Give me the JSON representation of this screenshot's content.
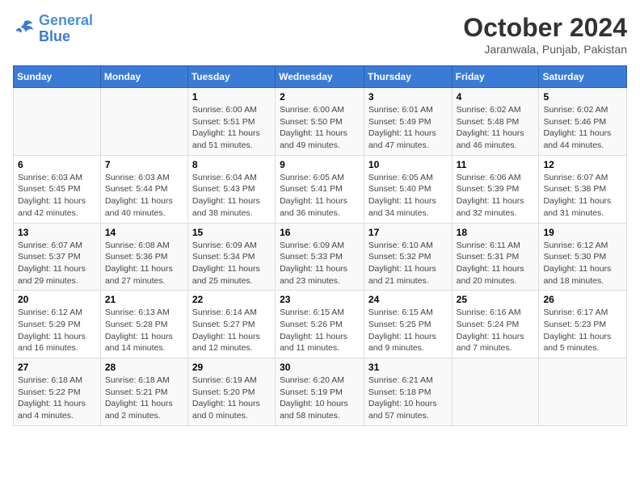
{
  "header": {
    "logo_line1": "General",
    "logo_line2": "Blue",
    "month": "October 2024",
    "location": "Jaranwala, Punjab, Pakistan"
  },
  "weekdays": [
    "Sunday",
    "Monday",
    "Tuesday",
    "Wednesday",
    "Thursday",
    "Friday",
    "Saturday"
  ],
  "weeks": [
    [
      {
        "day": "",
        "info": ""
      },
      {
        "day": "",
        "info": ""
      },
      {
        "day": "1",
        "info": "Sunrise: 6:00 AM\nSunset: 5:51 PM\nDaylight: 11 hours and 51 minutes."
      },
      {
        "day": "2",
        "info": "Sunrise: 6:00 AM\nSunset: 5:50 PM\nDaylight: 11 hours and 49 minutes."
      },
      {
        "day": "3",
        "info": "Sunrise: 6:01 AM\nSunset: 5:49 PM\nDaylight: 11 hours and 47 minutes."
      },
      {
        "day": "4",
        "info": "Sunrise: 6:02 AM\nSunset: 5:48 PM\nDaylight: 11 hours and 46 minutes."
      },
      {
        "day": "5",
        "info": "Sunrise: 6:02 AM\nSunset: 5:46 PM\nDaylight: 11 hours and 44 minutes."
      }
    ],
    [
      {
        "day": "6",
        "info": "Sunrise: 6:03 AM\nSunset: 5:45 PM\nDaylight: 11 hours and 42 minutes."
      },
      {
        "day": "7",
        "info": "Sunrise: 6:03 AM\nSunset: 5:44 PM\nDaylight: 11 hours and 40 minutes."
      },
      {
        "day": "8",
        "info": "Sunrise: 6:04 AM\nSunset: 5:43 PM\nDaylight: 11 hours and 38 minutes."
      },
      {
        "day": "9",
        "info": "Sunrise: 6:05 AM\nSunset: 5:41 PM\nDaylight: 11 hours and 36 minutes."
      },
      {
        "day": "10",
        "info": "Sunrise: 6:05 AM\nSunset: 5:40 PM\nDaylight: 11 hours and 34 minutes."
      },
      {
        "day": "11",
        "info": "Sunrise: 6:06 AM\nSunset: 5:39 PM\nDaylight: 11 hours and 32 minutes."
      },
      {
        "day": "12",
        "info": "Sunrise: 6:07 AM\nSunset: 5:38 PM\nDaylight: 11 hours and 31 minutes."
      }
    ],
    [
      {
        "day": "13",
        "info": "Sunrise: 6:07 AM\nSunset: 5:37 PM\nDaylight: 11 hours and 29 minutes."
      },
      {
        "day": "14",
        "info": "Sunrise: 6:08 AM\nSunset: 5:36 PM\nDaylight: 11 hours and 27 minutes."
      },
      {
        "day": "15",
        "info": "Sunrise: 6:09 AM\nSunset: 5:34 PM\nDaylight: 11 hours and 25 minutes."
      },
      {
        "day": "16",
        "info": "Sunrise: 6:09 AM\nSunset: 5:33 PM\nDaylight: 11 hours and 23 minutes."
      },
      {
        "day": "17",
        "info": "Sunrise: 6:10 AM\nSunset: 5:32 PM\nDaylight: 11 hours and 21 minutes."
      },
      {
        "day": "18",
        "info": "Sunrise: 6:11 AM\nSunset: 5:31 PM\nDaylight: 11 hours and 20 minutes."
      },
      {
        "day": "19",
        "info": "Sunrise: 6:12 AM\nSunset: 5:30 PM\nDaylight: 11 hours and 18 minutes."
      }
    ],
    [
      {
        "day": "20",
        "info": "Sunrise: 6:12 AM\nSunset: 5:29 PM\nDaylight: 11 hours and 16 minutes."
      },
      {
        "day": "21",
        "info": "Sunrise: 6:13 AM\nSunset: 5:28 PM\nDaylight: 11 hours and 14 minutes."
      },
      {
        "day": "22",
        "info": "Sunrise: 6:14 AM\nSunset: 5:27 PM\nDaylight: 11 hours and 12 minutes."
      },
      {
        "day": "23",
        "info": "Sunrise: 6:15 AM\nSunset: 5:26 PM\nDaylight: 11 hours and 11 minutes."
      },
      {
        "day": "24",
        "info": "Sunrise: 6:15 AM\nSunset: 5:25 PM\nDaylight: 11 hours and 9 minutes."
      },
      {
        "day": "25",
        "info": "Sunrise: 6:16 AM\nSunset: 5:24 PM\nDaylight: 11 hours and 7 minutes."
      },
      {
        "day": "26",
        "info": "Sunrise: 6:17 AM\nSunset: 5:23 PM\nDaylight: 11 hours and 5 minutes."
      }
    ],
    [
      {
        "day": "27",
        "info": "Sunrise: 6:18 AM\nSunset: 5:22 PM\nDaylight: 11 hours and 4 minutes."
      },
      {
        "day": "28",
        "info": "Sunrise: 6:18 AM\nSunset: 5:21 PM\nDaylight: 11 hours and 2 minutes."
      },
      {
        "day": "29",
        "info": "Sunrise: 6:19 AM\nSunset: 5:20 PM\nDaylight: 11 hours and 0 minutes."
      },
      {
        "day": "30",
        "info": "Sunrise: 6:20 AM\nSunset: 5:19 PM\nDaylight: 10 hours and 58 minutes."
      },
      {
        "day": "31",
        "info": "Sunrise: 6:21 AM\nSunset: 5:18 PM\nDaylight: 10 hours and 57 minutes."
      },
      {
        "day": "",
        "info": ""
      },
      {
        "day": "",
        "info": ""
      }
    ]
  ]
}
